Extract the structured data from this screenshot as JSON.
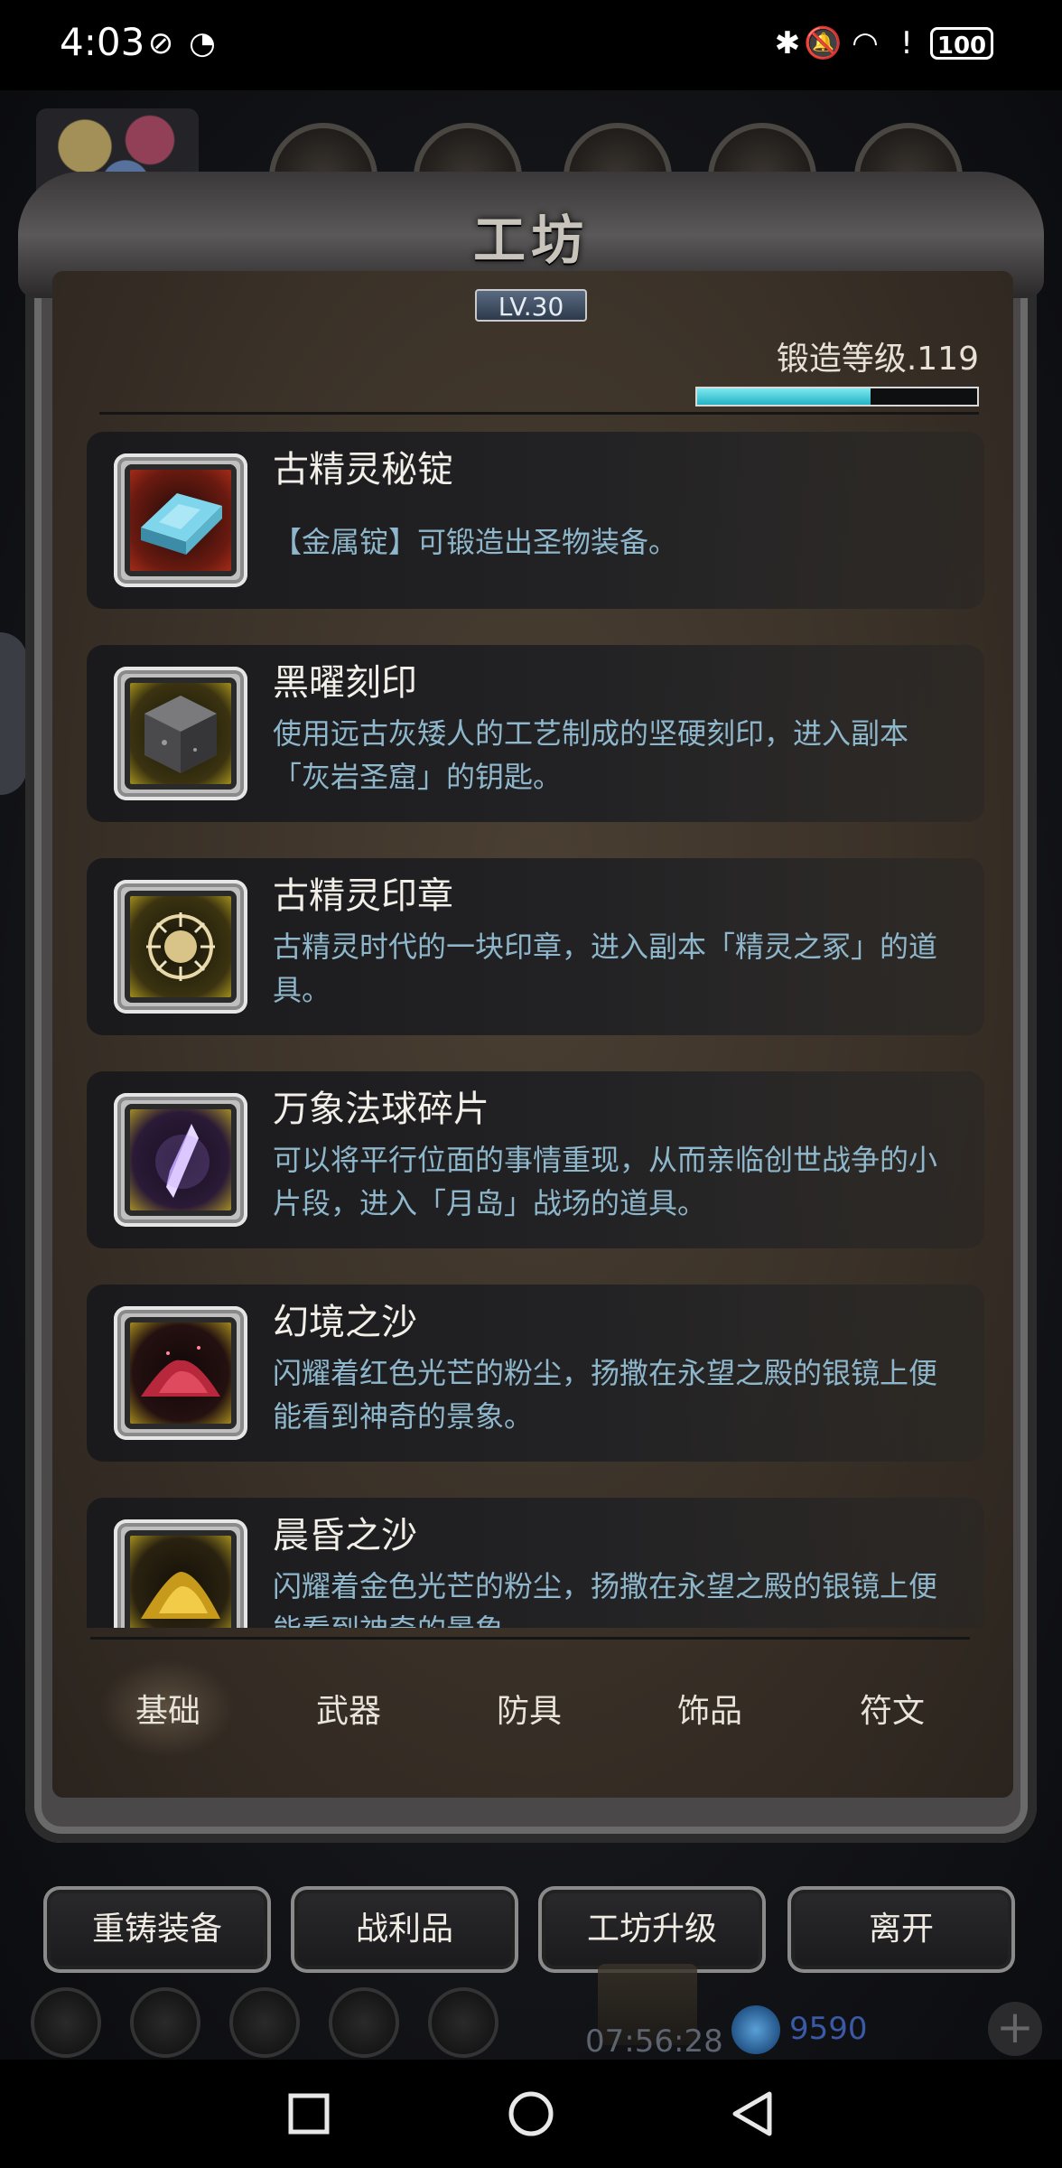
{
  "status_bar": {
    "time": "4:03",
    "icons": [
      "no-signal-icon",
      "speed-icon",
      "bluetooth-icon",
      "mute-icon",
      "wifi-icon",
      "alert-icon"
    ],
    "battery": "100"
  },
  "workshop": {
    "title": "工坊",
    "level_badge": "LV.30",
    "forge_level_label": "锻造等级.119",
    "forge_progress": 0.62
  },
  "items": [
    {
      "name": "古精灵秘锭",
      "desc": "【金属锭】可锻造出圣物装备。",
      "frame": "red",
      "icon": "ingot-icon"
    },
    {
      "name": "黑曜刻印",
      "desc": "使用远古灰矮人的工艺制成的坚硬刻印，进入副本「灰岩圣窟」的钥匙。",
      "frame": "gold",
      "icon": "obsidian-seal-icon"
    },
    {
      "name": "古精灵印章",
      "desc": "古精灵时代的一块印章，进入副本「精灵之冢」的道具。",
      "frame": "gold",
      "icon": "elf-seal-icon"
    },
    {
      "name": "万象法球碎片",
      "desc": "可以将平行位面的事情重现，从而亲临创世战争的小片段，进入「月岛」战场的道具。",
      "frame": "gold",
      "icon": "crystal-shard-icon"
    },
    {
      "name": "幻境之沙",
      "desc": "闪耀着红色光芒的粉尘，扬撒在永望之殿的银镜上便能看到神奇的景象。",
      "frame": "gold",
      "icon": "red-sand-icon"
    },
    {
      "name": "晨昏之沙",
      "desc": "闪耀着金色光芒的粉尘，扬撒在永望之殿的银镜上便能看到神奇的景象。",
      "frame": "gold",
      "icon": "gold-sand-icon"
    }
  ],
  "categories": [
    "基础",
    "武器",
    "防具",
    "饰品",
    "符文"
  ],
  "active_category": "基础",
  "actions": [
    "重铸装备",
    "战利品",
    "工坊升级",
    "离开"
  ],
  "hud": {
    "timer": "07:56:28",
    "gems": "9590"
  },
  "nav": [
    "recent-apps-icon",
    "home-icon",
    "back-icon"
  ]
}
